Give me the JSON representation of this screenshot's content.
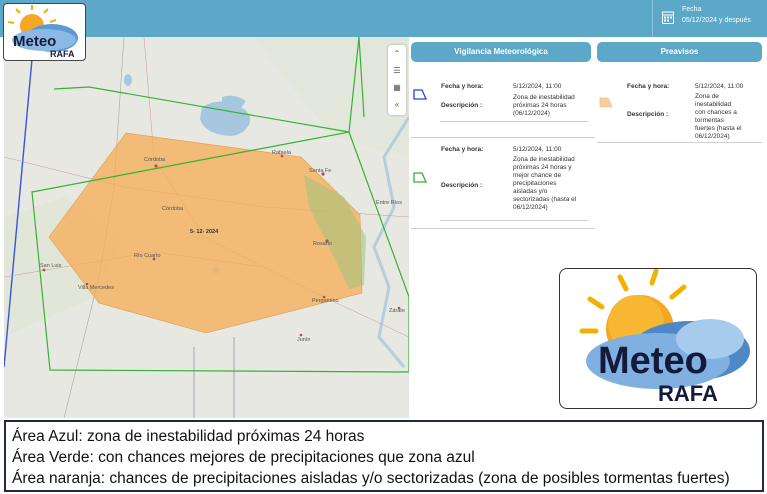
{
  "header": {
    "date_label": "Fecha",
    "date_value": "05/12/2024 y después"
  },
  "logo": {
    "line1": "Meteo",
    "line2": "RAFA"
  },
  "map": {
    "center_date_label": "5- 12- 2024",
    "places": [
      "Córdoba",
      "Rafaela",
      "Santa Fe",
      "Entre Ríos",
      "Córdoba",
      "Rosario",
      "Río Cuarto",
      "San Luis",
      "Villa Mercedes",
      "Pergamino",
      "Junín",
      "Zárate"
    ],
    "colors": {
      "orange_zone": "#f5b05c",
      "green_zone": "#32b432",
      "blue_zone": "#2244cc"
    },
    "controls": [
      "chevrons-up-icon",
      "layers-icon",
      "qr-icon",
      "chevrons-left-icon"
    ]
  },
  "vigilancia": {
    "title": "Vigilancia Meteorológica",
    "entries": [
      {
        "fecha_label": "Fecha y hora:",
        "fecha_value": "5/12/2024, 11:00",
        "desc_label": "Descripción :",
        "desc_lines": [
          "Zona de inestabilidad",
          "próximas 24 horas",
          "(06/12/2024)"
        ],
        "color": "#2244cc"
      },
      {
        "fecha_label": "Fecha y hora:",
        "fecha_value": "5/12/2024, 11:00",
        "desc_label": "Descripción :",
        "desc_lines": [
          "Zona de inestabilidad",
          "próximas 24 horas y",
          "mejor chance de",
          "precipitaciones",
          "aisladas y/o",
          "sectorizadas (hasta el",
          "06/12/2024)"
        ],
        "color": "#32b432"
      }
    ]
  },
  "preavisos": {
    "title": "Preavisos",
    "entries": [
      {
        "fecha_label": "Fecha y hora:",
        "fecha_value": "5/12/2024, 11:00",
        "desc_label": "Descripción :",
        "desc_lines": [
          "Zona de",
          "inestabilidad",
          "con chances a tormentas",
          "fuertes (hasta el",
          "06/12/2024)"
        ],
        "color": "#f5cf9e"
      }
    ]
  },
  "legend": [
    "Área Azul: zona de inestabilidad próximas 24 horas",
    "Área Verde: con chances mejores de precipitaciones que zona azul",
    "Área naranja: chances de precipitaciones aisladas y/o sectorizadas (zona de posibles tormentas fuertes)"
  ]
}
